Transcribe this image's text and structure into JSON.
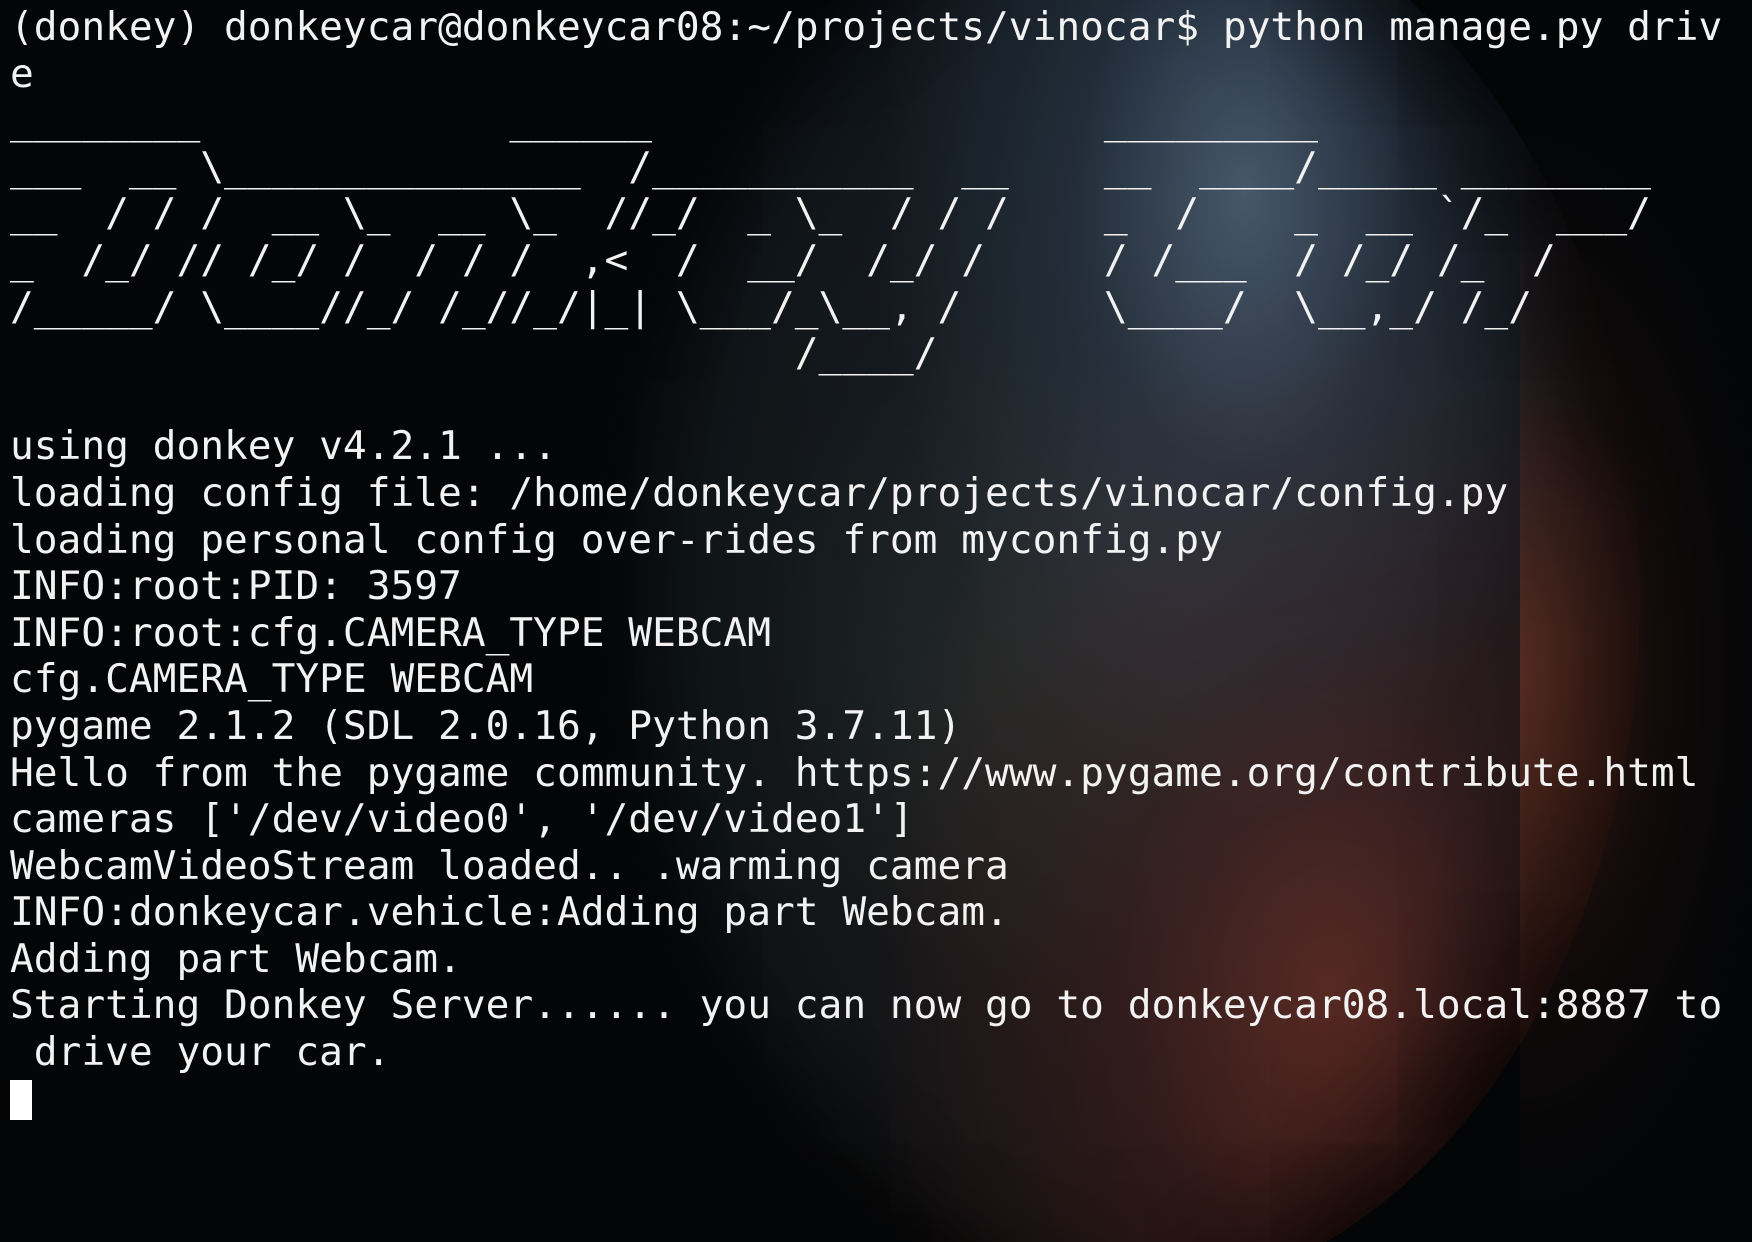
{
  "terminal": {
    "background_color": "#030507",
    "text_color": "#f2f2f2",
    "lines": [
      "(donkey) donkeycar@donkeycar08:~/projects/vinocar$ python manage.py driv",
      "e",
      "________             ______                   _________              ",
      "___  __ \\_______________  /___________  __    __  ____/_____ ________",
      "__  / / /  __ \\_  __ \\_  //_/  _ \\_  / / /    _  /    _  __ `/_  ___/",
      "_  /_/ // /_/ /  / / /  ,<  /  __/  /_/ /     / /___  / /_/ /_  /    ",
      "/_____/ \\____//_/ /_//_/|_| \\___/_\\__, /      \\____/  \\__,_/ /_/     ",
      "                                 /____/                              ",
      "",
      "using donkey v4.2.1 ...",
      "loading config file: /home/donkeycar/projects/vinocar/config.py",
      "loading personal config over-rides from myconfig.py",
      "INFO:root:PID: 3597",
      "INFO:root:cfg.CAMERA_TYPE WEBCAM",
      "cfg.CAMERA_TYPE WEBCAM",
      "pygame 2.1.2 (SDL 2.0.16, Python 3.7.11)",
      "Hello from the pygame community. https://www.pygame.org/contribute.html",
      "cameras ['/dev/video0', '/dev/video1']",
      "WebcamVideoStream loaded.. .warming camera",
      "INFO:donkeycar.vehicle:Adding part Webcam.",
      "Adding part Webcam.",
      "Starting Donkey Server...... you can now go to donkeycar08.local:8887 to",
      " drive your car."
    ]
  }
}
